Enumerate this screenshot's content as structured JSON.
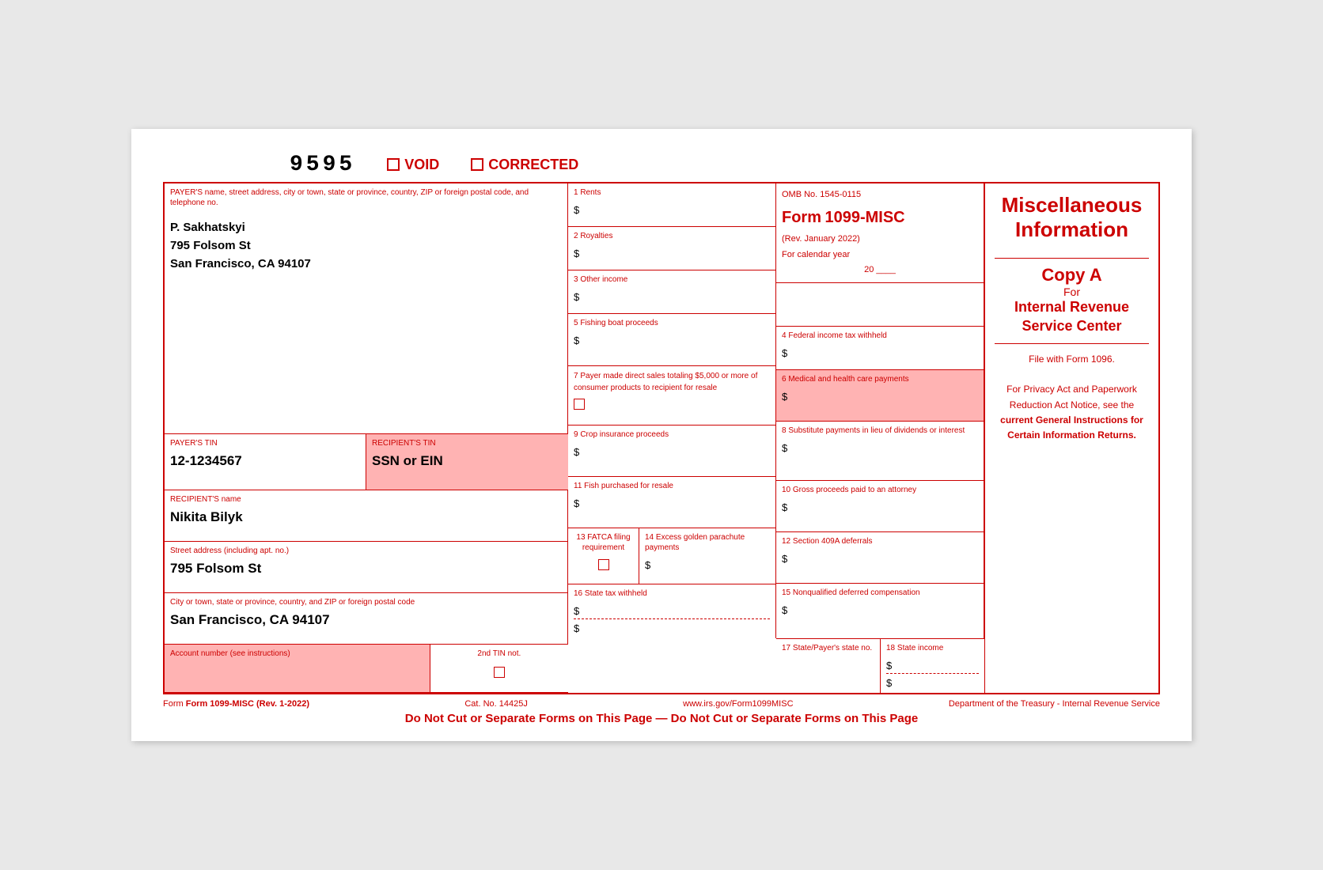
{
  "form_number": "9595",
  "void_label": "VOID",
  "corrected_label": "CORRECTED",
  "payer": {
    "section_label": "PAYER'S name, street address, city or town, state or province, country, ZIP or foreign postal code, and telephone no.",
    "name": "P. Sakhatskyi",
    "address": "795 Folsom St",
    "city_state_zip": "San Francisco, CA 94107"
  },
  "payer_tin": {
    "label": "PAYER'S TIN",
    "value": "12-1234567"
  },
  "recipient_tin": {
    "label": "RECIPIENT'S TIN",
    "value": "SSN or EIN"
  },
  "recipient_name": {
    "label": "RECIPIENT'S name",
    "value": "Nikita Bilyk"
  },
  "street_address": {
    "label": "Street address (including apt. no.)",
    "value": "795 Folsom St"
  },
  "city_state": {
    "label": "City or town, state or province, country, and ZIP or foreign postal code",
    "value": "San Francisco, CA 94107"
  },
  "account_number": {
    "label": "Account number (see instructions)"
  },
  "second_tin": {
    "label": "2nd TIN not."
  },
  "fields": {
    "rents": {
      "label": "1 Rents",
      "dollar": "$"
    },
    "royalties": {
      "label": "2 Royalties",
      "dollar": "$"
    },
    "other_income": {
      "label": "3 Other income",
      "dollar": "$"
    },
    "federal_tax": {
      "label": "4 Federal income tax withheld",
      "dollar": "$"
    },
    "fishing": {
      "label": "5 Fishing boat proceeds",
      "dollar": "$"
    },
    "medical": {
      "label": "6 Medical and health care payments",
      "dollar": "$"
    },
    "direct_sales": {
      "label": "7 Payer made direct sales totaling $5,000 or more of consumer products to recipient for resale"
    },
    "substitute": {
      "label": "8 Substitute payments in lieu of dividends or interest",
      "dollar": "$"
    },
    "crop": {
      "label": "9 Crop insurance proceeds",
      "dollar": "$"
    },
    "gross_proceeds": {
      "label": "10 Gross proceeds paid to an attorney",
      "dollar": "$"
    },
    "fish_resale": {
      "label": "11 Fish purchased for resale",
      "dollar": "$"
    },
    "section409": {
      "label": "12 Section 409A deferrals",
      "dollar": "$"
    },
    "fatca": {
      "label": "13 FATCA filing requirement"
    },
    "excess": {
      "label": "14 Excess golden parachute payments",
      "dollar": "$"
    },
    "nonqualified": {
      "label": "15 Nonqualified deferred compensation",
      "dollar": "$"
    },
    "state_tax": {
      "label": "16 State tax withheld",
      "dollar1": "$",
      "dollar2": "$"
    },
    "state_payer": {
      "label": "17 State/Payer's state no."
    },
    "state_income": {
      "label": "18 State income",
      "dollar1": "$",
      "dollar2": "$"
    }
  },
  "omb": {
    "number": "OMB No. 1545-0115",
    "form": "Form",
    "form_name": "1099-MISC",
    "rev": "(Rev. January 2022)",
    "cal_year_label": "For calendar year",
    "cal_year": "20 ____"
  },
  "info_panel": {
    "title_line1": "Miscellaneous",
    "title_line2": "Information",
    "copy": "Copy A",
    "for": "For",
    "irs_line1": "Internal Revenue",
    "irs_line2": "Service Center",
    "file_with": "File with Form 1096.",
    "privacy_text": "For Privacy Act and Paperwork Reduction Act Notice, see the",
    "instructions": "current General Instructions for Certain Information Returns."
  },
  "footer": {
    "form_ref": "Form 1099-MISC (Rev. 1-2022)",
    "cat": "Cat. No. 14425J",
    "website": "www.irs.gov/Form1099MISC",
    "dept": "Department of the Treasury - Internal Revenue Service",
    "do_not_cut": "Do Not Cut or Separate Forms on This Page — Do Not Cut or Separate Forms on This Page"
  }
}
